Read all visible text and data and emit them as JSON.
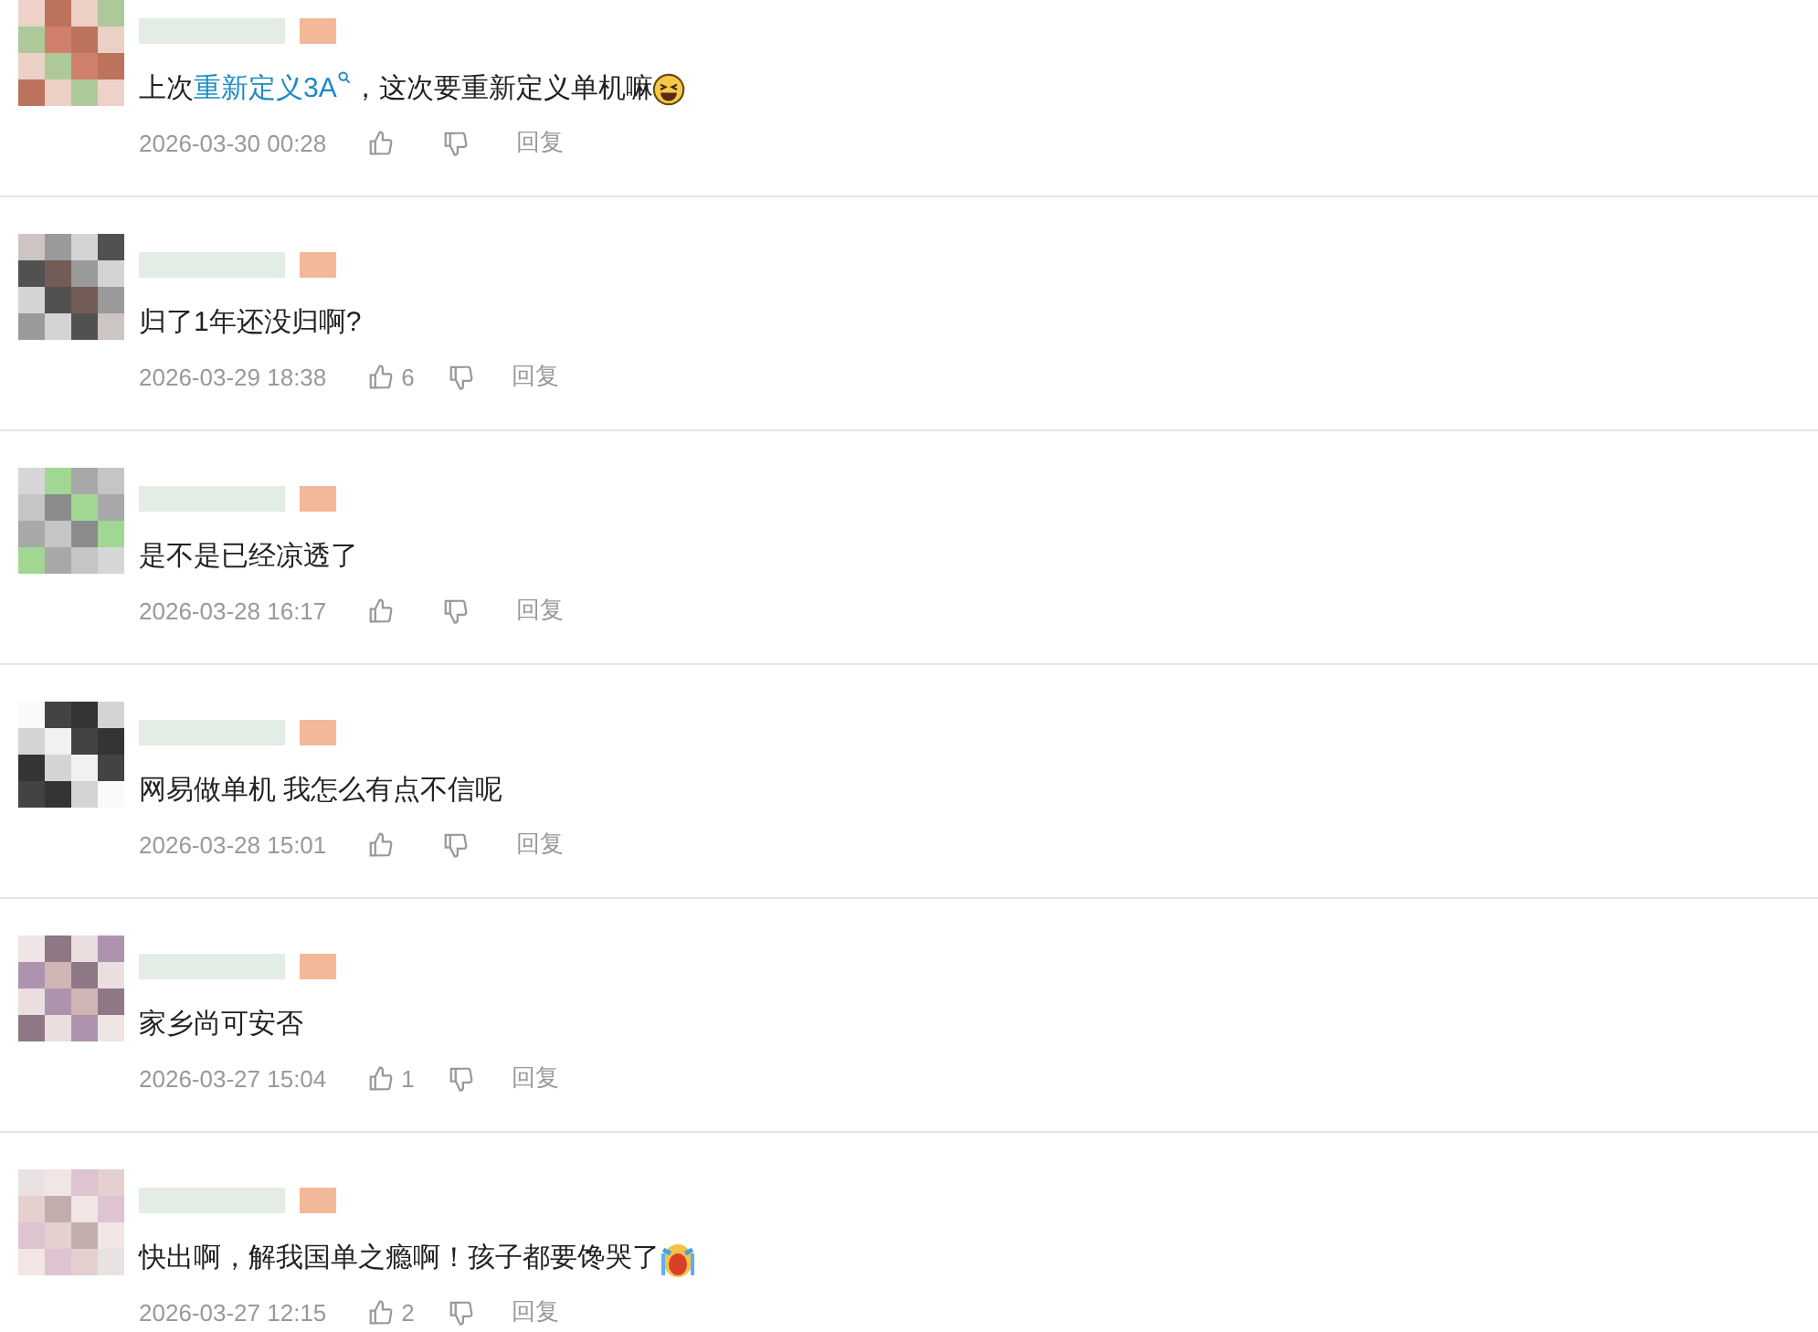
{
  "comments": [
    {
      "content": [
        {
          "kind": "text",
          "text": "上次"
        },
        {
          "kind": "link",
          "text": "重新定义3A"
        },
        {
          "kind": "text",
          "text": "，这次要重新定义单机嘛"
        },
        {
          "kind": "grin"
        }
      ],
      "time": "2026-03-30 00:28",
      "reply": "回复"
    },
    {
      "content": [
        {
          "kind": "text",
          "text": "归了1年还没归啊?"
        }
      ],
      "time": "2026-03-29 18:38",
      "likes": "6",
      "reply": "回复"
    },
    {
      "content": [
        {
          "kind": "text",
          "text": "是不是已经凉透了"
        }
      ],
      "time": "2026-03-28 16:17",
      "reply": "回复"
    },
    {
      "content": [
        {
          "kind": "text",
          "text": "网易做单机 我怎么有点不信呢"
        }
      ],
      "time": "2026-03-28 15:01",
      "reply": "回复"
    },
    {
      "content": [
        {
          "kind": "text",
          "text": "家乡尚可安否"
        }
      ],
      "time": "2026-03-27 15:04",
      "likes": "1",
      "reply": "回复"
    },
    {
      "content": [
        {
          "kind": "text",
          "text": "快出啊，解我国单之瘾啊！孩子都要馋哭了"
        },
        {
          "kind": "cry"
        }
      ],
      "time": "2026-03-27 12:15",
      "likes": "2",
      "reply": "回复"
    }
  ]
}
